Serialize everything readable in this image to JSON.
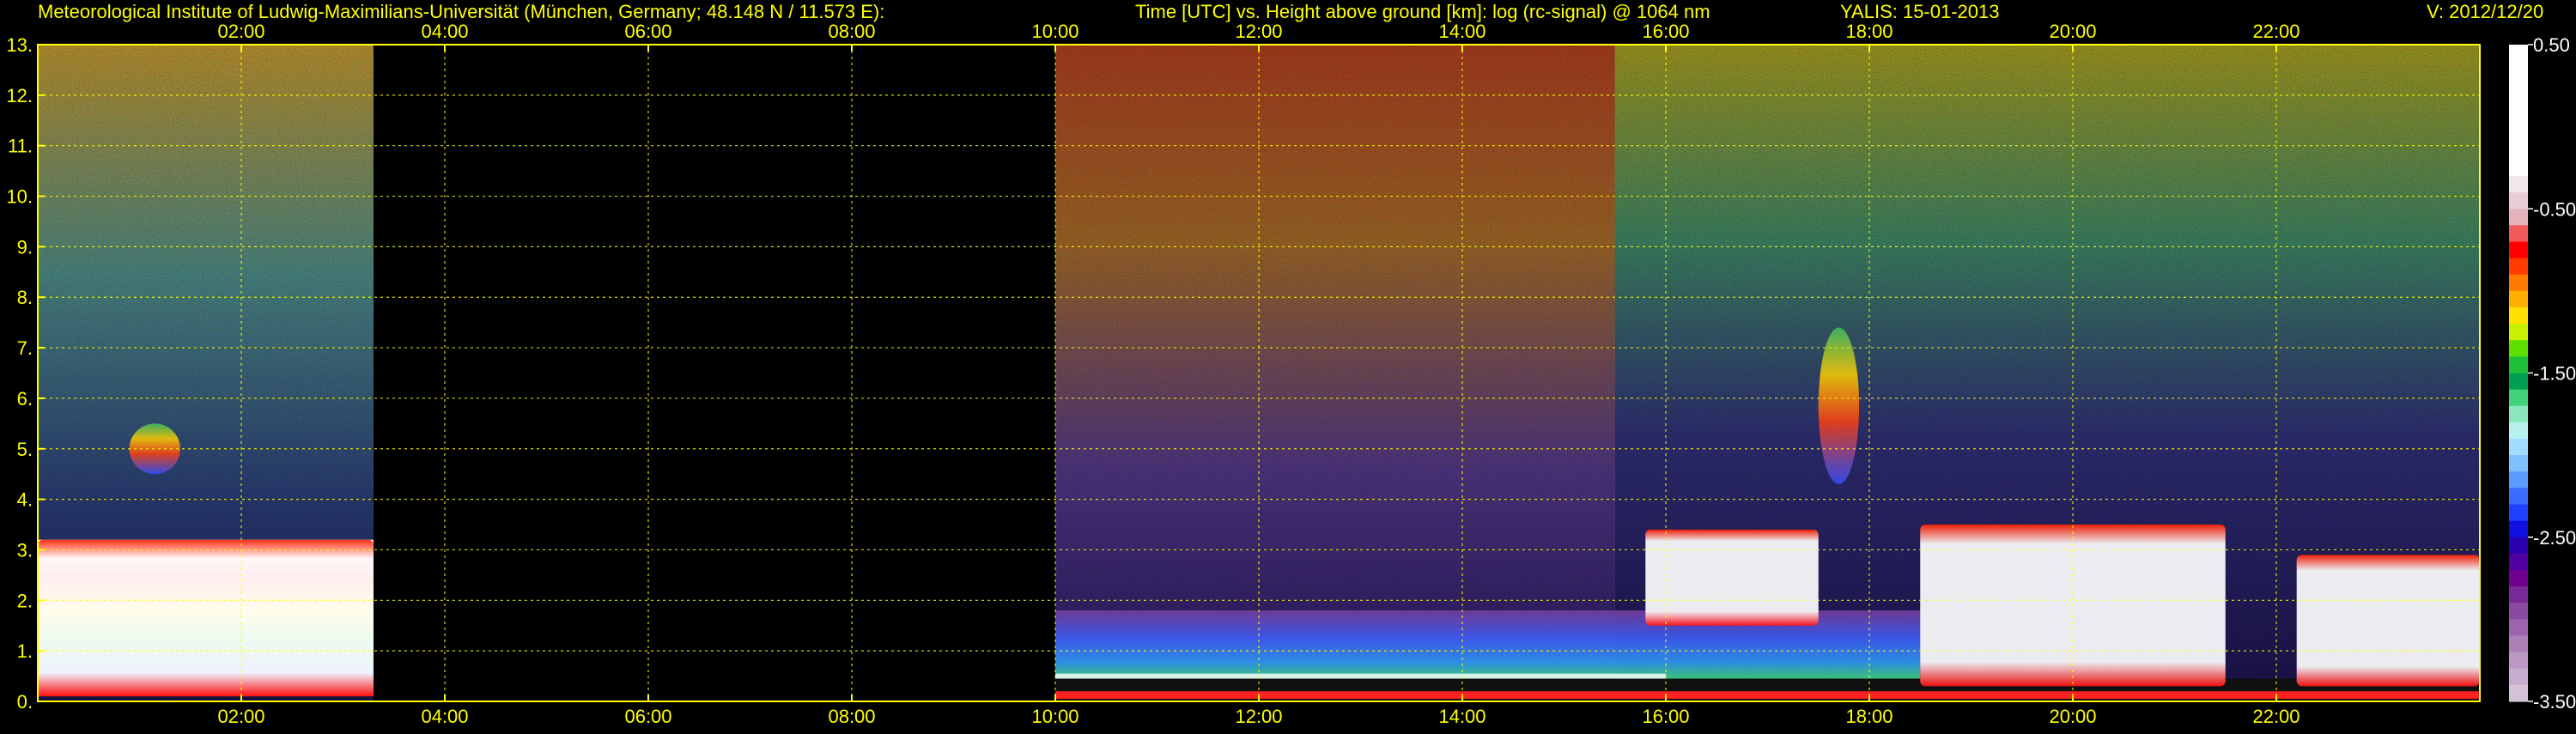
{
  "header": {
    "left": "Meteorological Institute of Ludwig-Maximilians-Universität (München, Germany; 48.148 N / 11.573 E):",
    "center": "Time [UTC] vs. Height above ground [km]: log (rc-signal) @ 1064 nm",
    "station": "YALIS: 15-01-2013",
    "version": "V: 2012/12/20"
  },
  "colors": {
    "background": "#000000",
    "axis": "#ffff00",
    "grid": "#ffff00",
    "text": "#ffff00"
  },
  "chart_data": {
    "type": "heatmap",
    "title": "Time [UTC] vs. Height above ground [km]: log (rc-signal) @ 1064 nm",
    "xlabel": "Time [UTC]",
    "ylabel": "Height above ground [km]",
    "xlim": [
      0,
      24
    ],
    "ylim": [
      0,
      13
    ],
    "x_ticks": [
      2,
      4,
      6,
      8,
      10,
      12,
      14,
      16,
      18,
      20,
      22
    ],
    "x_tick_labels": [
      "02:00",
      "04:00",
      "06:00",
      "08:00",
      "10:00",
      "12:00",
      "14:00",
      "16:00",
      "18:00",
      "20:00",
      "22:00"
    ],
    "y_ticks": [
      0,
      1,
      2,
      3,
      4,
      5,
      6,
      7,
      8,
      9,
      10,
      11,
      12,
      13
    ],
    "y_tick_labels": [
      "0.",
      "1.",
      "2.",
      "3.",
      "4.",
      "5.",
      "6.",
      "7.",
      "8.",
      "9.",
      "10.",
      "11.",
      "12.",
      "13."
    ],
    "grid": true,
    "data_gap_utc": [
      3.3,
      10.0
    ],
    "features": [
      {
        "t_start": 0.0,
        "t_end": 3.3,
        "h_bottom": 0.1,
        "h_top": 3.2,
        "level": "high"
      },
      {
        "t_start": 0.9,
        "t_end": 1.4,
        "h_bottom": 4.5,
        "h_top": 5.5,
        "level": "medium"
      },
      {
        "t_start": 10.0,
        "t_end": 24.0,
        "h_bottom": 0.0,
        "h_top": 0.45,
        "level": "very-high"
      },
      {
        "t_start": 10.0,
        "t_end": 18.5,
        "h_bottom": 0.45,
        "h_top": 1.8,
        "level": "medium"
      },
      {
        "t_start": 15.8,
        "t_end": 17.5,
        "h_bottom": 1.5,
        "h_top": 3.4,
        "level": "high"
      },
      {
        "t_start": 17.5,
        "t_end": 17.9,
        "h_bottom": 4.3,
        "h_top": 7.4,
        "level": "medium"
      },
      {
        "t_start": 18.5,
        "t_end": 21.5,
        "h_bottom": 0.3,
        "h_top": 3.5,
        "level": "high"
      },
      {
        "t_start": 22.2,
        "t_end": 24.0,
        "h_bottom": 0.3,
        "h_top": 2.9,
        "level": "high"
      }
    ],
    "colorbar": {
      "range": [
        -3.5,
        0.5
      ],
      "tick_values": [
        0.5,
        -0.5,
        -1.5,
        -2.5,
        -3.5
      ],
      "tick_labels": [
        "0.50",
        "-0.50",
        "-1.50",
        "-2.50",
        "-3.50"
      ],
      "colors_top_to_bottom": [
        "#ffffff",
        "#ffffff",
        "#ffffff",
        "#ffffff",
        "#ffffff",
        "#ffffff",
        "#ffffff",
        "#ffffff",
        "#f2e6ea",
        "#e8cdd4",
        "#e6b3bd",
        "#f05a5a",
        "#ff0000",
        "#ff3d00",
        "#ff7a00",
        "#ffb000",
        "#ffe000",
        "#c8f000",
        "#5de000",
        "#1fbf3a",
        "#00a050",
        "#3fd27a",
        "#8be6bf",
        "#b8f0ee",
        "#a0dcff",
        "#7fc0ff",
        "#5a9cff",
        "#3a6cff",
        "#2040ff",
        "#1010e0",
        "#2a00b0",
        "#5000a0",
        "#700090",
        "#7a2a98",
        "#8a4aa0",
        "#9c64ae",
        "#ad80b8",
        "#bc98c4",
        "#c8aece",
        "#d4c2d8"
      ]
    }
  }
}
